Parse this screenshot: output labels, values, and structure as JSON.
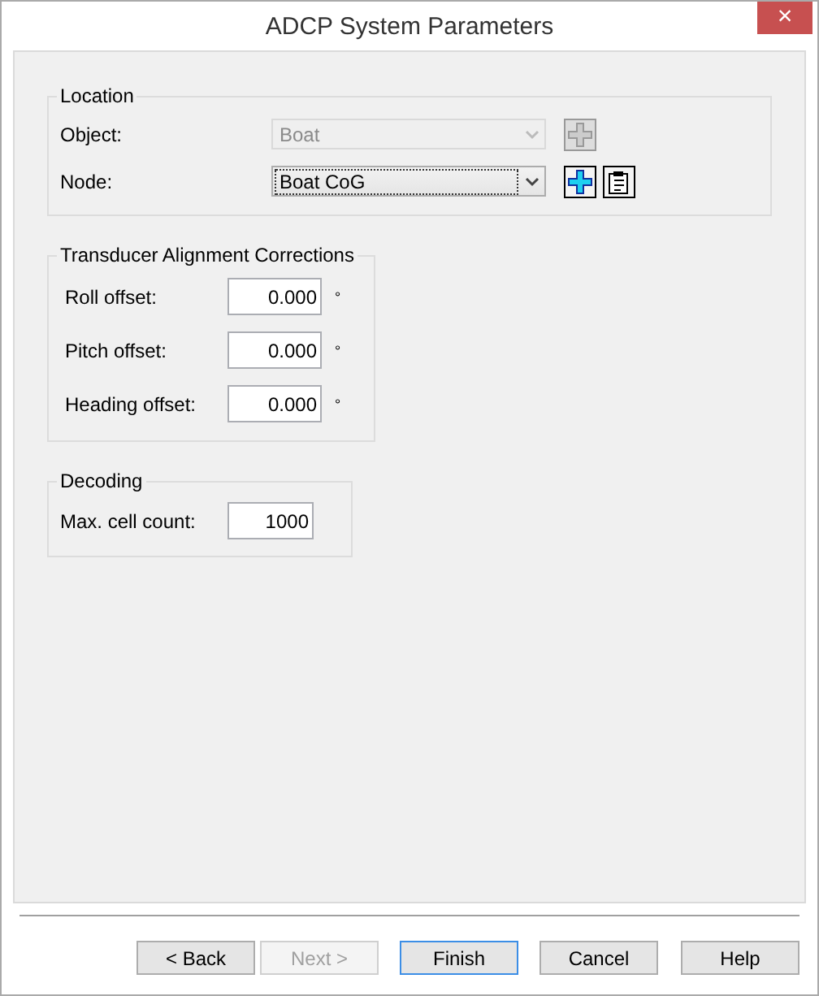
{
  "window": {
    "title": "ADCP System Parameters",
    "close": "×"
  },
  "location": {
    "title": "Location",
    "fields": [
      {
        "label": "Object:",
        "value": "Boat",
        "disabled": true,
        "buttons": [
          {
            "kind": "add"
          }
        ]
      },
      {
        "label": "Node:",
        "value": "Boat CoG",
        "disabled": false,
        "buttons": [
          {
            "kind": "add"
          },
          {
            "kind": "properties"
          }
        ]
      }
    ]
  },
  "alignment": {
    "title": "Transducer Alignment Corrections",
    "fields": [
      {
        "label": "Roll offset:",
        "value": "0.000",
        "unit": "°"
      },
      {
        "label": "Pitch offset:",
        "value": "0.000",
        "unit": "°"
      },
      {
        "label": "Heading offset:",
        "value": "0.000",
        "unit": "°"
      }
    ]
  },
  "decoding": {
    "title": "Decoding",
    "fields": [
      {
        "label": "Max. cell count:",
        "value": "1000"
      }
    ]
  },
  "buttons": [
    {
      "label": "< Back",
      "disabled": false,
      "default": false
    },
    {
      "label": "Next >",
      "disabled": true,
      "default": false
    },
    {
      "label": "Finish",
      "disabled": false,
      "default": true
    },
    {
      "label": "Cancel",
      "disabled": false,
      "default": false
    },
    {
      "label": "Help",
      "disabled": false,
      "default": false
    }
  ]
}
